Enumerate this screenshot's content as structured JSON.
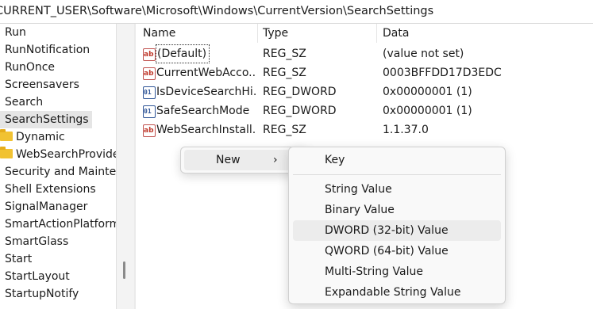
{
  "address_bar": {
    "path": "CURRENT_USER\\Software\\Microsoft\\Windows\\CurrentVersion\\SearchSettings"
  },
  "tree": {
    "items": [
      {
        "label": "Run",
        "type": "key"
      },
      {
        "label": "RunNotification",
        "type": "key"
      },
      {
        "label": "RunOnce",
        "type": "key"
      },
      {
        "label": "Screensavers",
        "type": "key"
      },
      {
        "label": "Search",
        "type": "key"
      },
      {
        "label": "SearchSettings",
        "type": "key",
        "selected": true
      },
      {
        "label": "Dynamic",
        "type": "folder"
      },
      {
        "label": "WebSearchProvide",
        "type": "folder"
      },
      {
        "label": "Security and Mainten",
        "type": "key"
      },
      {
        "label": "Shell Extensions",
        "type": "key"
      },
      {
        "label": "SignalManager",
        "type": "key"
      },
      {
        "label": "SmartActionPlatform",
        "type": "key"
      },
      {
        "label": "SmartGlass",
        "type": "key"
      },
      {
        "label": "Start",
        "type": "key"
      },
      {
        "label": "StartLayout",
        "type": "key"
      },
      {
        "label": "StartupNotify",
        "type": "key"
      }
    ]
  },
  "list": {
    "columns": {
      "name": "Name",
      "type": "Type",
      "data": "Data"
    },
    "rows": [
      {
        "icon": "string-value-icon",
        "name": "(Default)",
        "type": "REG_SZ",
        "data": "(value not set)"
      },
      {
        "icon": "string-value-icon",
        "name": "CurrentWebAcco...",
        "type": "REG_SZ",
        "data": "0003BFFDD17D3EDC"
      },
      {
        "icon": "binary-value-icon",
        "name": "IsDeviceSearchHi...",
        "type": "REG_DWORD",
        "data": "0x00000001 (1)"
      },
      {
        "icon": "binary-value-icon",
        "name": "SafeSearchMode",
        "type": "REG_DWORD",
        "data": "0x00000001 (1)"
      },
      {
        "icon": "string-value-icon",
        "name": "WebSearchInstall...",
        "type": "REG_SZ",
        "data": "1.1.37.0"
      }
    ]
  },
  "context_menu": {
    "new_label": "New",
    "arrow": "›"
  },
  "submenu": {
    "key": "Key",
    "items": [
      "String Value",
      "Binary Value",
      "DWORD (32-bit) Value",
      "QWORD (64-bit) Value",
      "Multi-String Value",
      "Expandable String Value"
    ],
    "hovered_index": 2
  }
}
